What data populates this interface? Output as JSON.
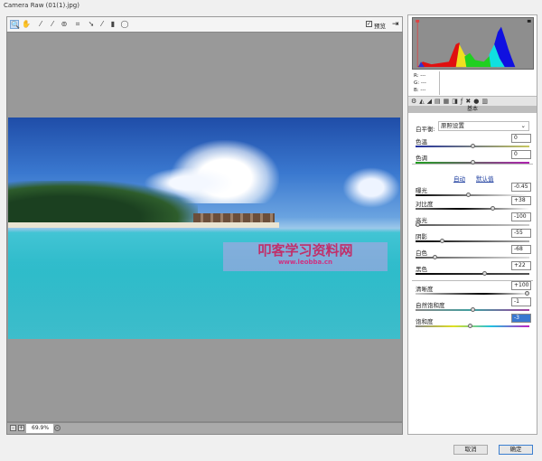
{
  "window": {
    "title": "Camera Raw (01(1).jpg)"
  },
  "toolbar": {
    "tools": [
      "zoom-icon",
      "hand-icon",
      "white-balance-icon",
      "color-sampler-icon",
      "targeted-adjust-icon",
      "crop-icon",
      "straighten-icon",
      "brush-icon",
      "trash-icon",
      "rotate-icon"
    ],
    "preview_label": "预览",
    "preview_checked": true
  },
  "image": {
    "watermark_title": "叩客学习资料网",
    "watermark_url": "www.leobba.cn"
  },
  "bottom": {
    "zoom": "69.9%"
  },
  "readout": {
    "r": "R:",
    "g": "G:",
    "b": "B:",
    "dash": "---"
  },
  "panel": {
    "section": "基本",
    "wb_label": "白平衡:",
    "wb_value": "原照设置",
    "auto": "自动",
    "default": "默认值",
    "sliders": [
      {
        "label": "色温",
        "value": "0",
        "pos": 0.5
      },
      {
        "label": "色调",
        "value": "0",
        "pos": 0.5
      },
      {
        "label": "曝光",
        "value": "-0.45",
        "pos": 0.46
      },
      {
        "label": "对比度",
        "value": "+38",
        "pos": 0.69
      },
      {
        "label": "高光",
        "value": "-100",
        "pos": 0.0
      },
      {
        "label": "阴影",
        "value": "-55",
        "pos": 0.22
      },
      {
        "label": "白色",
        "value": "-68",
        "pos": 0.16
      },
      {
        "label": "黑色",
        "value": "+22",
        "pos": 0.61
      },
      {
        "label": "清晰度",
        "value": "+100",
        "pos": 1.0
      },
      {
        "label": "自然饱和度",
        "value": "-1",
        "pos": 0.5
      },
      {
        "label": "饱和度",
        "value": "-3",
        "pos": 0.48
      }
    ]
  },
  "buttons": {
    "cancel": "取消",
    "ok": "确定"
  }
}
